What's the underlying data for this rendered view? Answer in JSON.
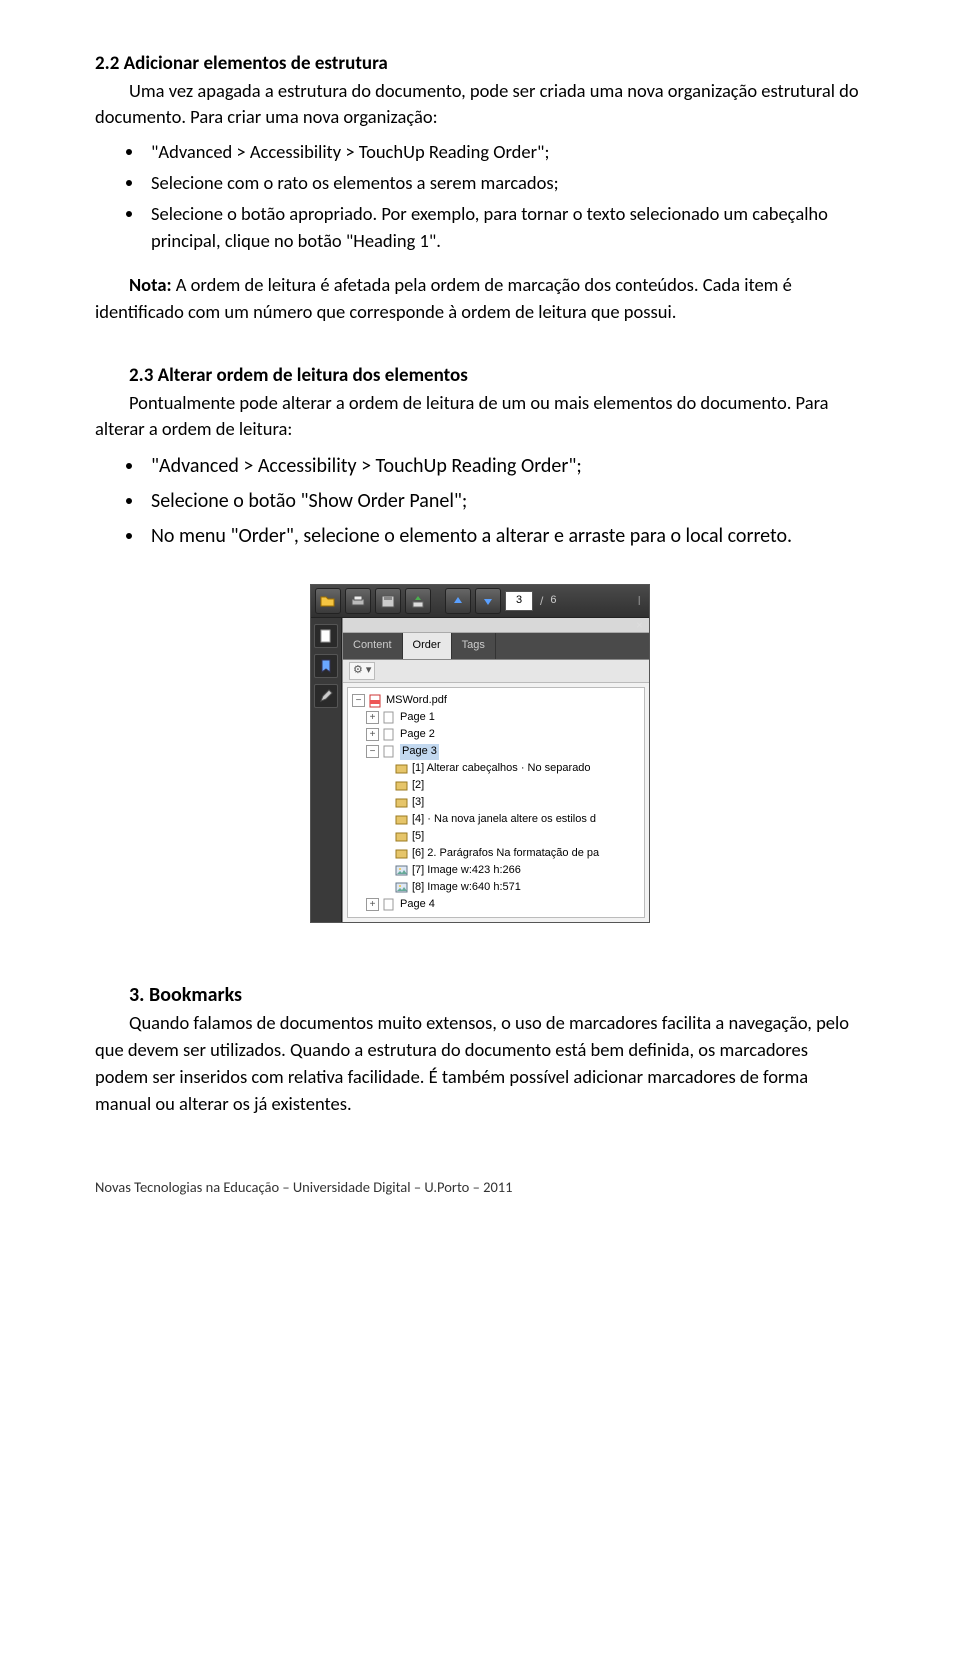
{
  "s22": {
    "heading": "2.2 Adicionar elementos de estrutura",
    "p1": "Uma vez apagada a estrutura do documento, pode ser criada uma nova organização estrutural do documento. Para criar uma nova organização:",
    "b1": "\"Advanced > Accessibility > TouchUp Reading Order\";",
    "b2": "Selecione com o rato os elementos a serem marcados;",
    "b3": "Selecione o botão apropriado. Por exemplo, para tornar o texto selecionado um cabeçalho principal, clique no botão \"Heading 1\".",
    "nota_label": "Nota:",
    "nota": " A ordem de leitura é afetada pela ordem de marcação dos conteúdos. Cada item é identificado com um número que corresponde à ordem de leitura que possui."
  },
  "s23": {
    "heading": "2.3 Alterar ordem de leitura dos elementos",
    "p1": "Pontualmente pode alterar a ordem de leitura de um ou mais elementos do documento. Para alterar a ordem de leitura:",
    "b1": "\"Advanced > Accessibility > TouchUp Reading Order\";",
    "b2": "Selecione o botão \"Show Order Panel\";",
    "b3": "No menu \"Order\", selecione o elemento a alterar e arraste para o local correto."
  },
  "app": {
    "page_current": "3",
    "page_total": "6",
    "tabs": {
      "content": "Content",
      "order": "Order",
      "tags": "Tags"
    },
    "close": "×",
    "file": "MSWord.pdf",
    "pages": {
      "p1": "Page 1",
      "p2": "Page 2",
      "p3": "Page 3",
      "p4": "Page 4"
    },
    "items": {
      "i1": "[1]   Alterar cabeçalhos · No separado",
      "i2": "[2]",
      "i3": "[3]",
      "i4": "[4]   · Na nova janela altere os estilos d",
      "i5": "[5]",
      "i6": "[6]   2. Parágrafos Na formatação de pa",
      "i7": "[7] Image  w:423 h:266",
      "i8": "[8] Image  w:640 h:571"
    }
  },
  "s3": {
    "heading": "3. Bookmarks",
    "p1": "Quando falamos de documentos muito extensos, o uso de marcadores facilita a navegação, pelo que devem ser utilizados. Quando a estrutura do documento está bem definida, os marcadores podem ser inseridos com relativa facilidade. É também possível adicionar marcadores de forma manual ou alterar os já existentes."
  },
  "footer": "Novas Tecnologias na Educação – Universidade Digital – U.Porto – 2011"
}
